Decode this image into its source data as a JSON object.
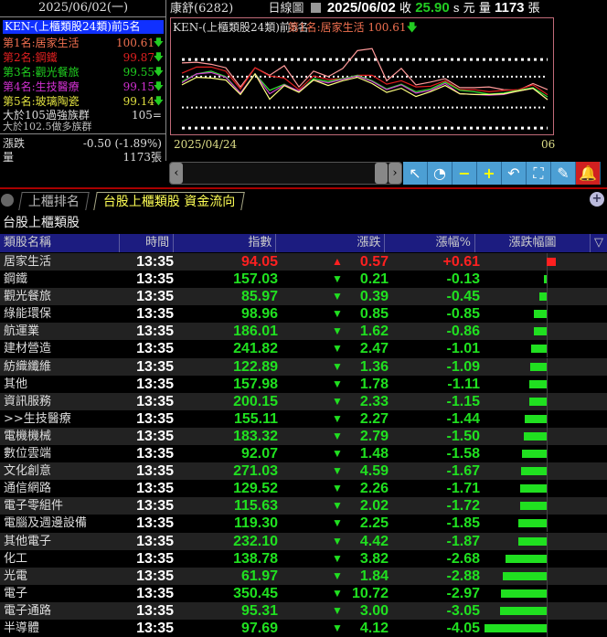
{
  "left": {
    "date": "2025/06/02(一)",
    "title": "KEN-(上櫃類股24類)前5名",
    "ranks": [
      {
        "label": "第1名:居家生活",
        "value": "100.61",
        "color": "#f07050"
      },
      {
        "label": "第2名:鋼鐵",
        "value": "99.87",
        "color": "#e02020"
      },
      {
        "label": "第3名:觀光餐旅",
        "value": "99.55",
        "color": "#20d020"
      },
      {
        "label": "第4名:生技醫療",
        "value": "99.15",
        "color": "#d030d0"
      },
      {
        "label": "第5名:玻璃陶瓷",
        "value": "99.14",
        "color": "#e0e040"
      }
    ],
    "arrow": "🡇",
    "strong_label": "大於105過強族群",
    "strong_value": "105=",
    "bull_label": "大於102.5做多族群",
    "change_label": "漲跌",
    "change_value": "-0.50 (-1.89%)",
    "volume_label": "量",
    "volume_value": "1173張"
  },
  "header": {
    "stock": "康舒(6282)",
    "chart_type": "日線圖",
    "date": "2025/06/02",
    "close_label": "收",
    "close": "25.90",
    "close_unit": "s 元",
    "vol_label": "量",
    "vol": "1173",
    "vol_unit": "張"
  },
  "chart": {
    "title": "KEN-(上櫃類股24類)前5名",
    "top_label": "第1名:居家生活 100.61",
    "start_date": "2025/04/24",
    "end_date": "06"
  },
  "chart_data": {
    "type": "line",
    "reference_lines": [
      105,
      102.5,
      98,
      95
    ],
    "series": [
      {
        "name": "居家生活",
        "color": "#ff9a9a",
        "values": [
          104.5,
          104.6,
          104.3,
          103.8,
          101.0,
          103.8,
          102.7,
          104.1,
          101.0,
          103.3,
          102.5,
          103.7,
          106.3,
          106.6,
          101.9,
          103.7,
          101.3,
          101.7,
          102.2,
          100.9,
          100.9,
          101.0,
          100.6,
          100.5,
          101.5,
          100.61
        ]
      },
      {
        "name": "鋼鐵",
        "color": "#e02020",
        "values": [
          103.0,
          103.9,
          103.9,
          103.3,
          100.7,
          103.8,
          102.6,
          102.3,
          100.6,
          102.6,
          102.1,
          102.2,
          102.7,
          102.7,
          101.4,
          101.9,
          101.0,
          101.1,
          101.9,
          100.6,
          100.6,
          100.3,
          100.5,
          100.6,
          101.3,
          99.87
        ]
      },
      {
        "name": "觀光餐旅",
        "color": "#30e030",
        "values": [
          101.8,
          102.9,
          103.3,
          102.5,
          100.1,
          102.9,
          100.5,
          101.4,
          100.3,
          102.2,
          101.8,
          102.2,
          102.7,
          101.9,
          100.7,
          101.4,
          100.3,
          100.7,
          101.7,
          100.5,
          100.3,
          99.95,
          100.1,
          100.5,
          100.9,
          99.55
        ]
      },
      {
        "name": "生技醫療",
        "color": "#d040d0",
        "values": [
          101.6,
          102.9,
          103.1,
          102.4,
          100.1,
          102.9,
          100.0,
          101.3,
          100.4,
          102.0,
          101.6,
          102.1,
          102.6,
          101.8,
          100.6,
          101.3,
          100.1,
          100.5,
          101.5,
          100.0,
          99.9,
          99.8,
          99.9,
          100.4,
          100.8,
          99.15
        ]
      },
      {
        "name": "玻璃陶瓷",
        "color": "#ffff80",
        "values": [
          101.3,
          102.4,
          102.3,
          102.0,
          99.9,
          102.9,
          99.2,
          101.2,
          100.2,
          102.0,
          101.2,
          101.9,
          102.4,
          101.5,
          100.2,
          100.8,
          99.6,
          100.3,
          101.2,
          100.0,
          99.9,
          99.9,
          100.0,
          100.4,
          100.8,
          99.14
        ]
      }
    ]
  },
  "toolbar": {
    "scroll_left": "‹",
    "scroll_right": "›",
    "buttons": [
      {
        "name": "cursor",
        "glyph": "↖"
      },
      {
        "name": "clock",
        "glyph": "◔"
      },
      {
        "name": "zoom-out",
        "glyph": "−"
      },
      {
        "name": "zoom-in",
        "glyph": "+"
      },
      {
        "name": "undo",
        "glyph": "↶"
      },
      {
        "name": "fit",
        "glyph": "⛶"
      },
      {
        "name": "draw",
        "glyph": "✎"
      },
      {
        "name": "alert",
        "glyph": "🔔"
      }
    ]
  },
  "tabs": [
    {
      "label": "上櫃排名"
    },
    {
      "label": "台股上櫃類股 資金流向"
    }
  ],
  "section_title": "台股上櫃類股",
  "columns": [
    "類股名稱",
    "時間",
    "指數",
    "漲跌",
    "漲幅%",
    "漲跌幅圖"
  ],
  "sort_glyph": "▽",
  "colors": {
    "up": "#ff2020",
    "down": "#20e020"
  },
  "rows": [
    {
      "name": "居家生活",
      "time": "13:35",
      "index": "94.05",
      "change": "0.57",
      "pct": "+0.61",
      "p": 0.61
    },
    {
      "name": "鋼鐵",
      "time": "13:35",
      "index": "157.03",
      "change": "0.21",
      "pct": "-0.13",
      "p": -0.13
    },
    {
      "name": "觀光餐旅",
      "time": "13:35",
      "index": "85.97",
      "change": "0.39",
      "pct": "-0.45",
      "p": -0.45
    },
    {
      "name": "綠能環保",
      "time": "13:35",
      "index": "98.96",
      "change": "0.85",
      "pct": "-0.85",
      "p": -0.85
    },
    {
      "name": "航運業",
      "time": "13:35",
      "index": "186.01",
      "change": "1.62",
      "pct": "-0.86",
      "p": -0.86
    },
    {
      "name": "建材營造",
      "time": "13:35",
      "index": "241.82",
      "change": "2.47",
      "pct": "-1.01",
      "p": -1.01
    },
    {
      "name": "紡織纖維",
      "time": "13:35",
      "index": "122.89",
      "change": "1.36",
      "pct": "-1.09",
      "p": -1.09
    },
    {
      "name": "其他",
      "time": "13:35",
      "index": "157.98",
      "change": "1.78",
      "pct": "-1.11",
      "p": -1.11
    },
    {
      "name": "資訊服務",
      "time": "13:35",
      "index": "200.15",
      "change": "2.33",
      "pct": "-1.15",
      "p": -1.15
    },
    {
      "name": ">>生技醫療",
      "time": "13:35",
      "index": "155.11",
      "change": "2.27",
      "pct": "-1.44",
      "p": -1.44
    },
    {
      "name": "電機機械",
      "time": "13:35",
      "index": "183.32",
      "change": "2.79",
      "pct": "-1.50",
      "p": -1.5
    },
    {
      "name": "數位雲端",
      "time": "13:35",
      "index": "92.07",
      "change": "1.48",
      "pct": "-1.58",
      "p": -1.58
    },
    {
      "name": "文化創意",
      "time": "13:35",
      "index": "271.03",
      "change": "4.59",
      "pct": "-1.67",
      "p": -1.67
    },
    {
      "name": "通信網路",
      "time": "13:35",
      "index": "129.52",
      "change": "2.26",
      "pct": "-1.71",
      "p": -1.71
    },
    {
      "name": "電子零組件",
      "time": "13:35",
      "index": "115.63",
      "change": "2.02",
      "pct": "-1.72",
      "p": -1.72
    },
    {
      "name": "電腦及週邊設備",
      "time": "13:35",
      "index": "119.30",
      "change": "2.25",
      "pct": "-1.85",
      "p": -1.85
    },
    {
      "name": "其他電子",
      "time": "13:35",
      "index": "232.10",
      "change": "4.42",
      "pct": "-1.87",
      "p": -1.87
    },
    {
      "name": "化工",
      "time": "13:35",
      "index": "138.78",
      "change": "3.82",
      "pct": "-2.68",
      "p": -2.68
    },
    {
      "name": "光電",
      "time": "13:35",
      "index": "61.97",
      "change": "1.84",
      "pct": "-2.88",
      "p": -2.88
    },
    {
      "name": "電子",
      "time": "13:35",
      "index": "350.45",
      "change": "10.72",
      "pct": "-2.97",
      "p": -2.97
    },
    {
      "name": "電子通路",
      "time": "13:35",
      "index": "95.31",
      "change": "3.00",
      "pct": "-3.05",
      "p": -3.05
    },
    {
      "name": "半導體",
      "time": "13:35",
      "index": "97.69",
      "change": "4.12",
      "pct": "-4.05",
      "p": -4.05
    }
  ]
}
